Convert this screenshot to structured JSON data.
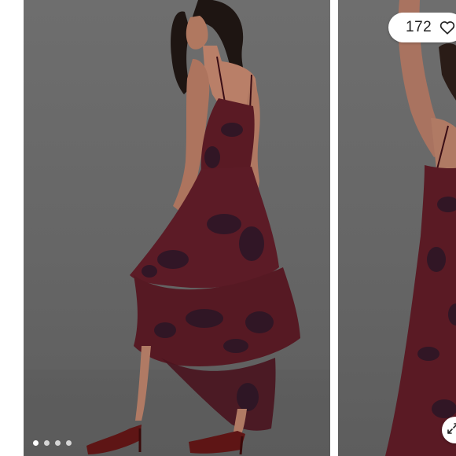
{
  "listing": {
    "likes": "172",
    "like_icon": "heart-outline-icon",
    "expand_icon": "expand-arrows-icon"
  },
  "carousel": {
    "photo_count": 4,
    "active_index": 1
  },
  "colors": {
    "backdrop": "#666666",
    "dress": "#5a1a24",
    "print": "#2a1626"
  }
}
